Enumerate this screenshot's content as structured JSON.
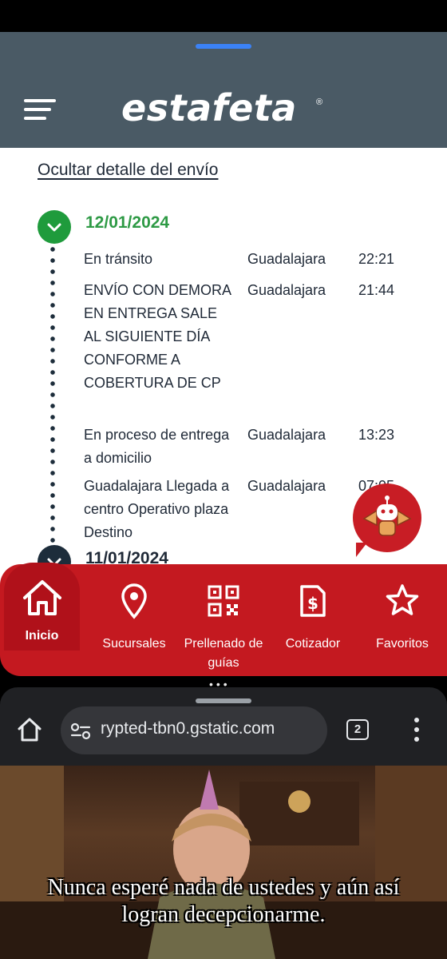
{
  "header": {
    "brand": "estafeta",
    "registered": "®"
  },
  "tracking": {
    "hide_detail_link": "Ocultar detalle del envío",
    "dates": [
      {
        "date": "12/01/2024",
        "events": [
          {
            "desc": "En tránsito",
            "city": "Guadalajara",
            "time": "22:21"
          },
          {
            "desc": "ENVÍO CON DEMORA EN ENTREGA SALE AL SIGUIENTE DÍA CONFORME A COBERTURA DE CP",
            "city": "Guadalajara",
            "time": "21:44"
          },
          {
            "desc": "En proceso de entrega a domicilio",
            "city": "Guadalajara",
            "time": "13:23"
          },
          {
            "desc": "Guadalajara Llegada a centro Operativo plaza Destino",
            "city": "Guadalajara",
            "time": "07:05"
          }
        ]
      },
      {
        "date": "11/01/2024",
        "events": []
      }
    ]
  },
  "bottom_nav": {
    "items": [
      {
        "label": "Inicio",
        "icon": "home-icon",
        "active": true
      },
      {
        "label": "Sucursales",
        "icon": "location-pin-icon"
      },
      {
        "label": "Prellenado de guías",
        "icon": "qr-code-icon"
      },
      {
        "label": "Cotizador",
        "icon": "dollar-document-icon"
      },
      {
        "label": "Favoritos",
        "icon": "star-icon"
      }
    ]
  },
  "browser": {
    "url": "rypted-tbn0.gstatic.com",
    "tab_count": "2"
  },
  "meme": {
    "caption_line1": "Nunca esperé nada de ustedes y aún así",
    "caption_line2": "logran decepcionarme."
  },
  "colors": {
    "header_bg": "#4a5a65",
    "nav_red": "#c41920",
    "date_green": "#2e9a45",
    "browser_bg": "#202124"
  }
}
